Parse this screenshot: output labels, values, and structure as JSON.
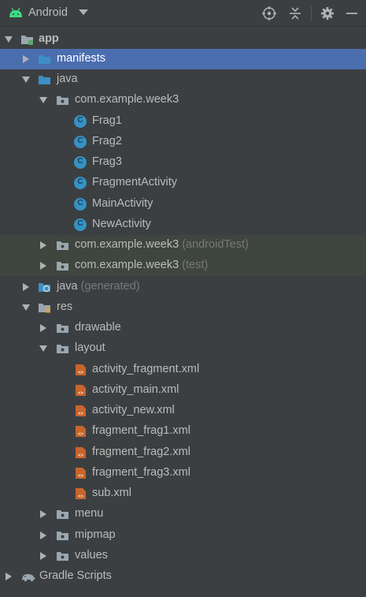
{
  "toolbar": {
    "title": "Android",
    "colors": {
      "accent_android": "#3ddc84",
      "icon": "#afb1b3"
    },
    "icons": [
      "android-icon",
      "dropdown-arrow-icon",
      "locate-icon",
      "collapse-all-icon",
      "gear-icon",
      "minimize-icon"
    ]
  },
  "tree": {
    "app": "app",
    "manifests": "manifests",
    "java": "java",
    "pkg_main": "com.example.week3",
    "classes": [
      "Frag1",
      "Frag2",
      "Frag3",
      "FragmentActivity",
      "MainActivity",
      "NewActivity"
    ],
    "pkg_android_test": "com.example.week3",
    "pkg_android_test_suffix": "(androidTest)",
    "pkg_test": "com.example.week3",
    "pkg_test_suffix": "(test)",
    "java_generated": "java",
    "java_generated_suffix": "(generated)",
    "res": "res",
    "drawable": "drawable",
    "layout": "layout",
    "layout_files": [
      "activity_fragment.xml",
      "activity_main.xml",
      "activity_new.xml",
      "fragment_frag1.xml",
      "fragment_frag2.xml",
      "fragment_frag3.xml",
      "sub.xml"
    ],
    "menu": "menu",
    "mipmap": "mipmap",
    "values": "values",
    "gradle": "Gradle Scripts"
  },
  "colors": {
    "selection": "#4b6eaf",
    "test_highlight": "#3f463f",
    "folder_blue": "#3d8fc5",
    "folder_gray": "#9aa7b0",
    "class_icon": "#3592c4",
    "xml_icon": "#c7652c"
  }
}
